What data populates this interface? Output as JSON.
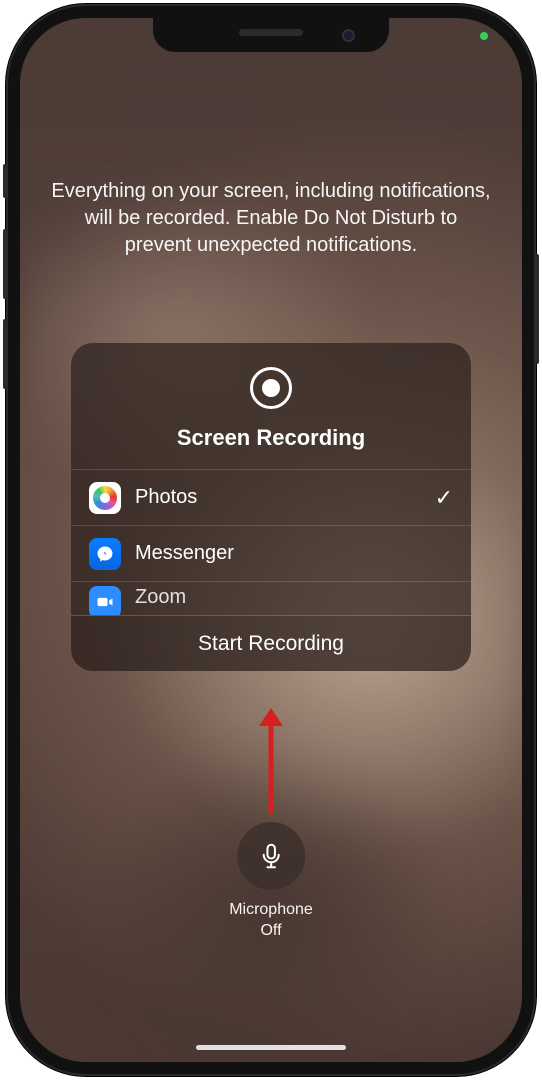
{
  "description": "Everything on your screen, including notifications, will be recorded. Enable Do Not Disturb to prevent unexpected notifications.",
  "card": {
    "title": "Screen Recording",
    "start_label": "Start Recording"
  },
  "apps": [
    {
      "name": "Photos",
      "selected": true
    },
    {
      "name": "Messenger",
      "selected": false
    },
    {
      "name": "Zoom",
      "selected": false
    }
  ],
  "mic": {
    "label": "Microphone",
    "state": "Off"
  }
}
